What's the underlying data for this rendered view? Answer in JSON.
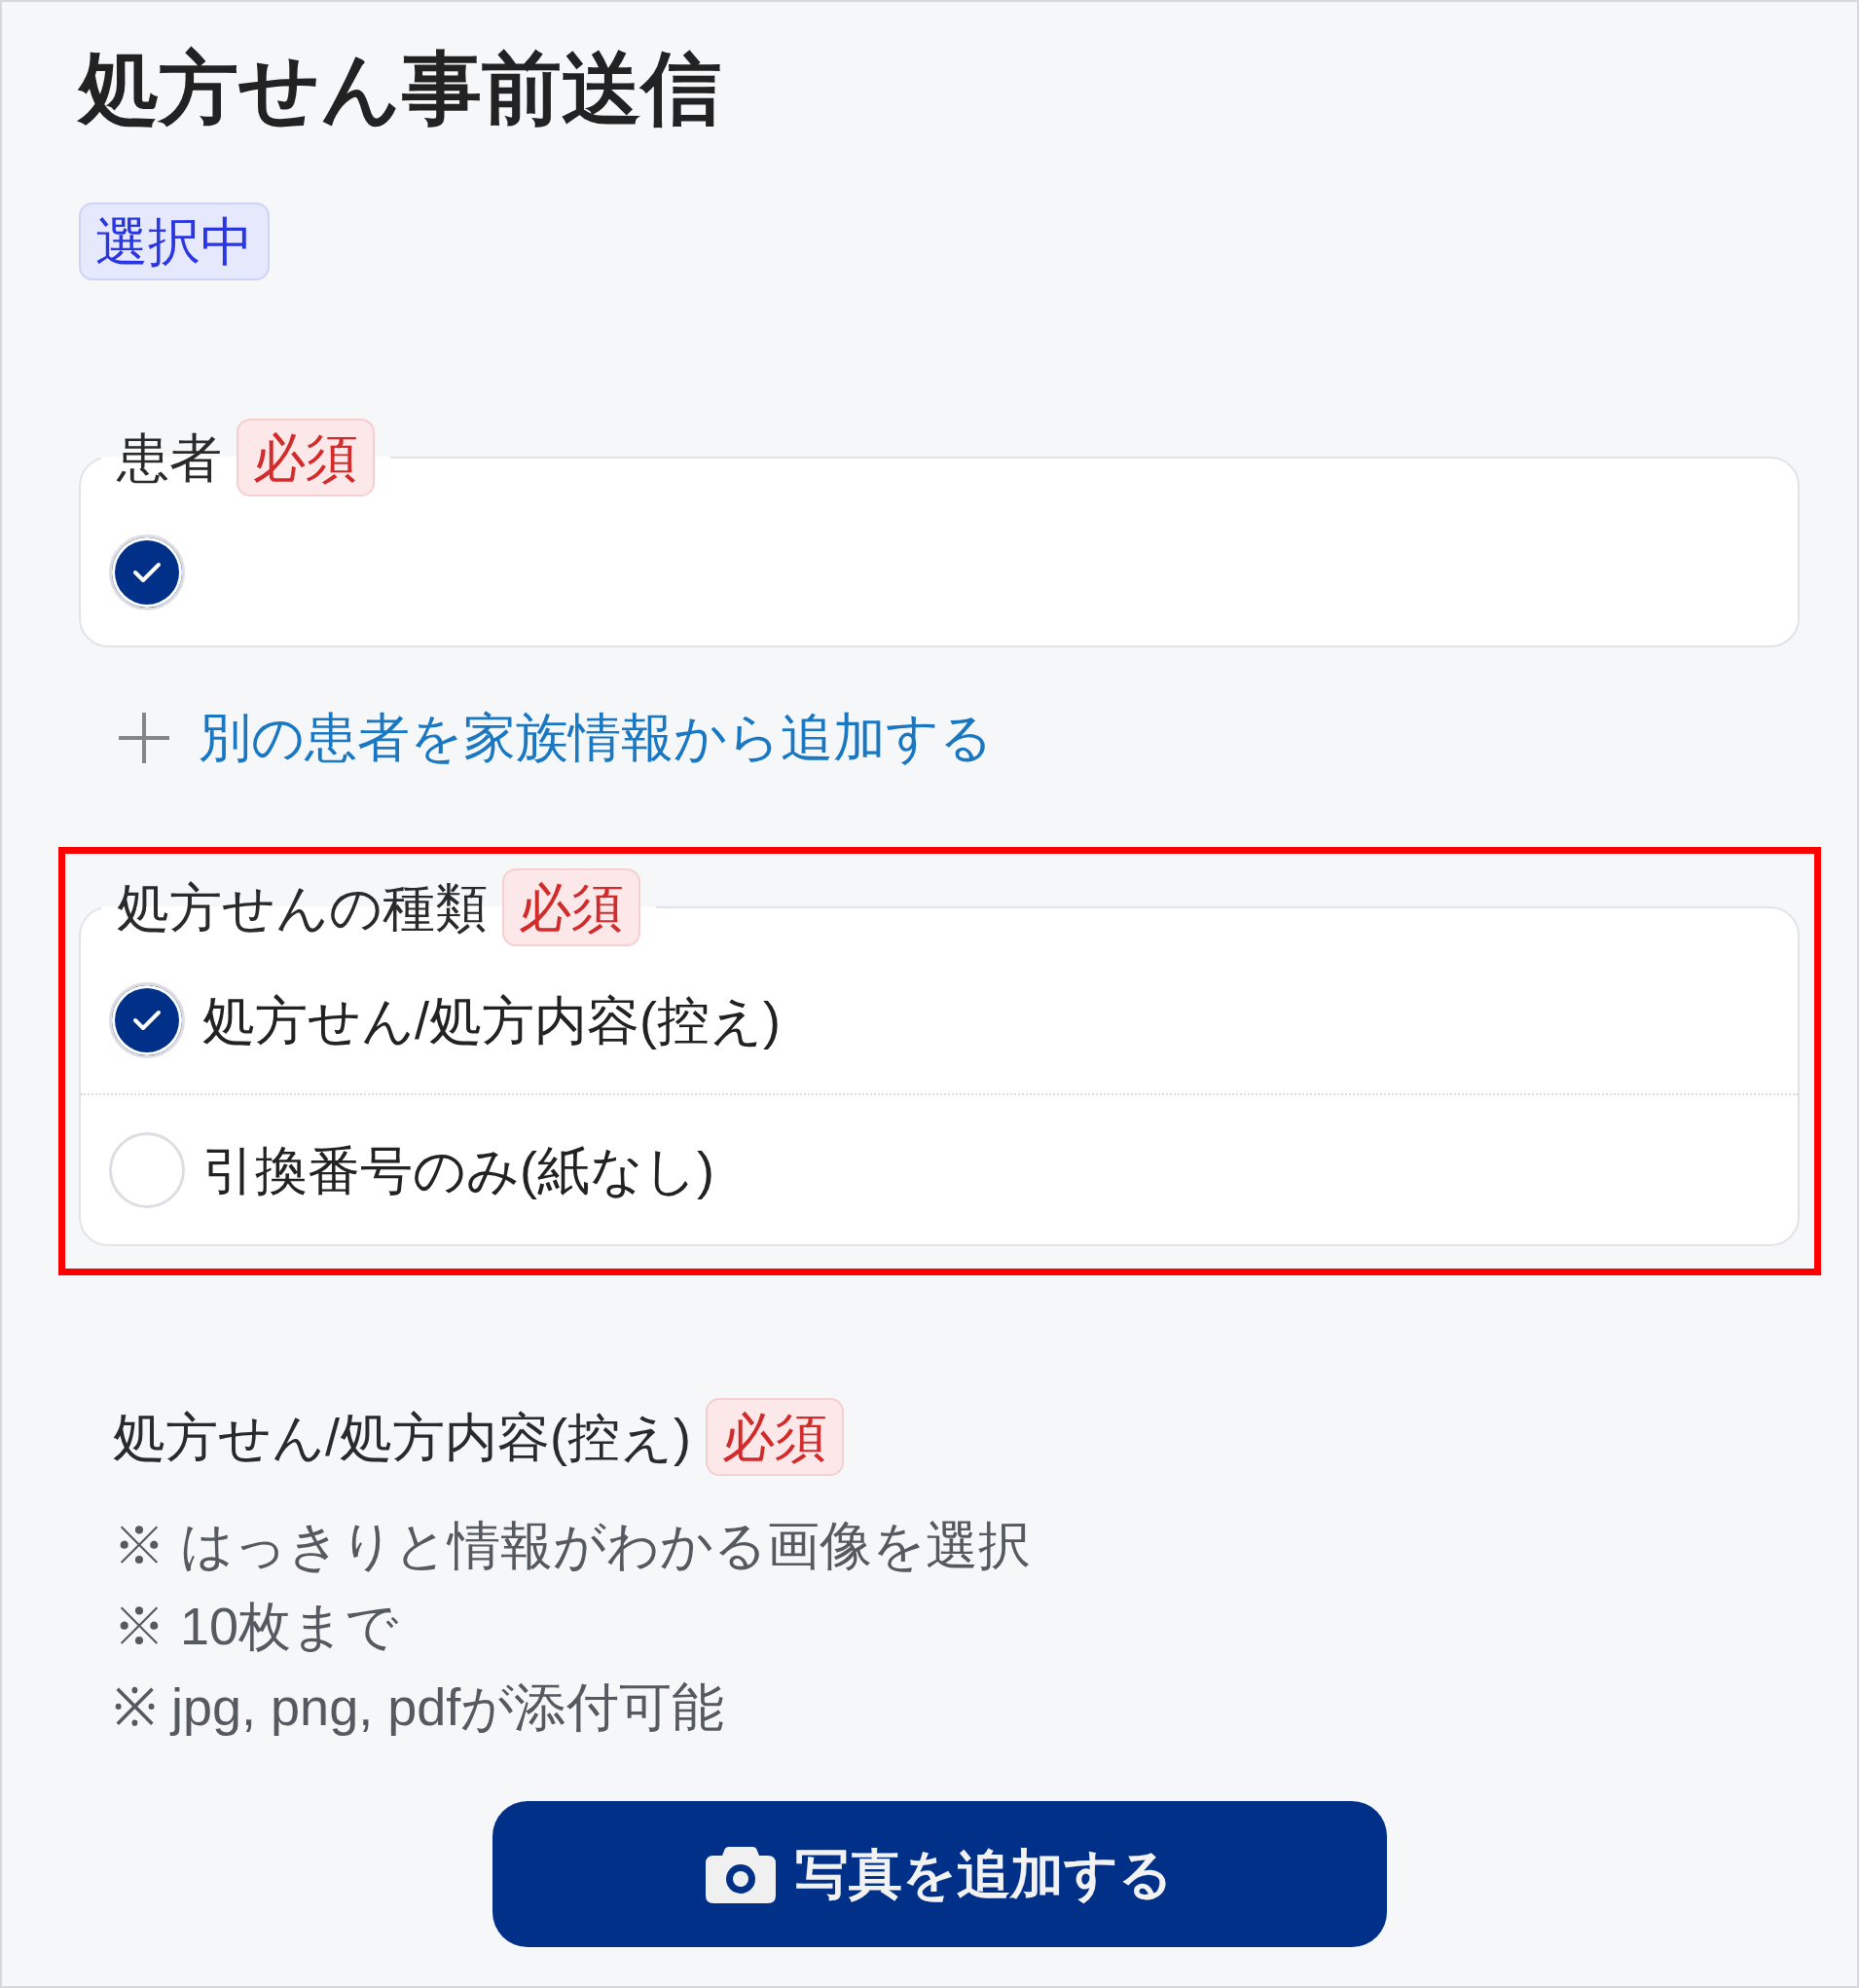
{
  "title": "処方せん事前送信",
  "status_badge": "選択中",
  "patient_field": {
    "label": "患者",
    "required_badge": "必須",
    "patients": [
      {
        "checked": true
      }
    ]
  },
  "add_patient_link": "別の患者を家族情報から追加する",
  "prescription_type": {
    "highlighted": true,
    "label": "処方せんの種類",
    "required_badge": "必須",
    "options": [
      {
        "label": "処方せん/処方内容(控え)",
        "selected": true
      },
      {
        "label": "引換番号のみ(紙なし)",
        "selected": false
      }
    ]
  },
  "upload": {
    "label": "処方せん/処方内容(控え)",
    "required_badge": "必須",
    "notes": [
      "※ はっきりと情報がわかる画像を選択",
      "※ 10枚まで",
      "※ jpg, png, pdfが添付可能"
    ],
    "button": "写真を追加する"
  }
}
